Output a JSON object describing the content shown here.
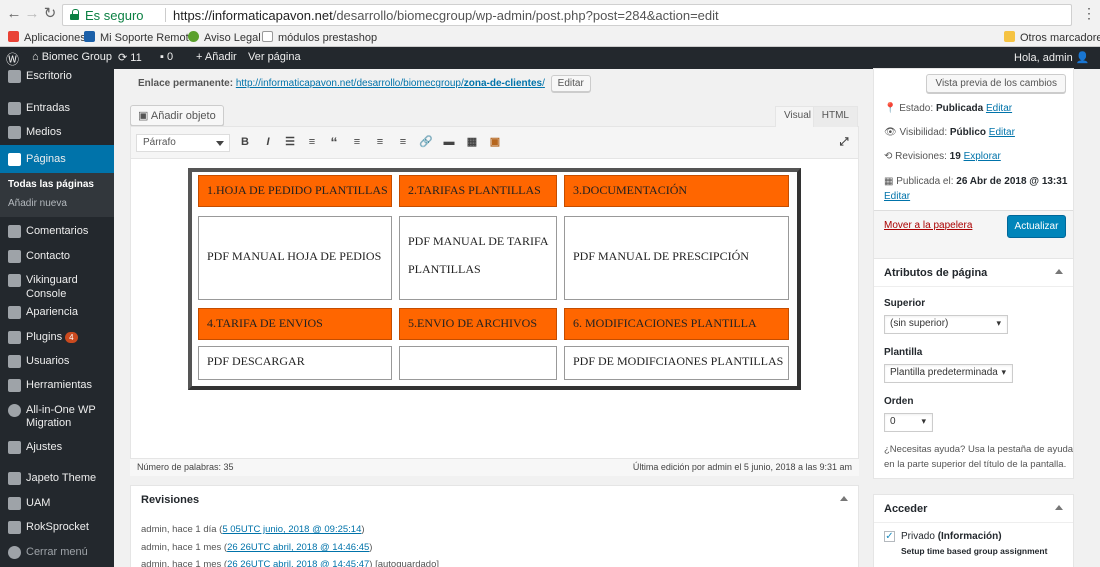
{
  "browser": {
    "secure_label": "Es seguro",
    "url_host": "https://informaticapavon.net",
    "url_path": "/desarrollo/biomecgroup/wp-admin/post.php?post=284&action=edit",
    "bookmarks": [
      "Aplicaciones",
      "Mi Soporte Remoto",
      "Aviso Legal",
      "módulos prestashop"
    ],
    "other_bookmarks": "Otros marcadores"
  },
  "adminbar": {
    "site_name": "Biomec Group",
    "updates_count": "11",
    "comments_count": "0",
    "new_label": "Añadir",
    "view_page": "Ver página",
    "greeting": "Hola, admin"
  },
  "sidebar": {
    "items": [
      {
        "label": "Escritorio"
      },
      {
        "label": "Entradas"
      },
      {
        "label": "Medios"
      },
      {
        "label": "Páginas"
      },
      {
        "label": "Comentarios"
      },
      {
        "label": "Contacto"
      },
      {
        "label": "Vikinguard Console"
      },
      {
        "label": "Apariencia"
      },
      {
        "label": "Plugins"
      },
      {
        "label": "Usuarios"
      },
      {
        "label": "Herramientas"
      },
      {
        "label": "All-in-One WP"
      },
      {
        "label": "Ajustes"
      },
      {
        "label": "Japeto Theme"
      },
      {
        "label": "UAM"
      },
      {
        "label": "RokSprocket"
      },
      {
        "label": "Cerrar menú"
      }
    ],
    "aio_line2": "Migration",
    "plugins_badge": "4",
    "submenu": [
      "Todas las páginas",
      "Añadir nueva"
    ]
  },
  "permalink": {
    "label": "Enlace permanente:",
    "url_base": "http://informaticapavon.net/desarrollo/biomecgroup/",
    "slug": "zona-de-clientes",
    "url_end": "/",
    "edit_button": "Editar"
  },
  "editor": {
    "add_media": "Añadir objeto",
    "tab_visual": "Visual",
    "tab_html": "HTML",
    "format_select": "Párrafo",
    "table": {
      "row1": [
        "1.HOJA DE PEDIDO PLANTILLAS",
        "2.TARIFAS PLANTILLAS",
        "3.DOCUMENTACIÓN"
      ],
      "row2": [
        "PDF  MANUAL HOJA DE PEDIOS",
        "PDF  MANUAL DE TARIFA",
        "PLANTILLAS",
        "PDF  MANUAL DE PRESCIPCIÓN"
      ],
      "row3": [
        "4.TARIFA DE ENVIOS",
        "5.ENVIO DE ARCHIVOS",
        "6. MODIFICACIONES PLANTILLA"
      ],
      "row4": [
        "PDF DESCARGAR",
        "",
        "PDF  DE MODIFCIAONES PLANTILLAS"
      ]
    },
    "word_count": "Número de palabras: 35",
    "last_edit": "Última edición por admin el 5 junio, 2018 a las 9:31 am",
    "colors": {
      "orange_cell": "#ff6600"
    }
  },
  "revisions": {
    "title": "Revisiones",
    "entries": [
      {
        "prefix": "admin, hace 1 día (",
        "link": "5 05UTC junio, 2018 @ 09:25:14",
        "suffix": ")"
      },
      {
        "prefix": "admin, hace 1 mes (",
        "link": "26 26UTC abril, 2018 @ 14:46:45",
        "suffix": ")"
      },
      {
        "prefix": "admin, hace 1 mes (",
        "link": "26 26UTC abril, 2018 @ 14:45:47",
        "suffix": ") [autoguardado]"
      }
    ]
  },
  "publish": {
    "preview_button": "Vista previa de los cambios",
    "status_label": "Estado:",
    "status_value": "Publicada",
    "visibility_label": "Visibilidad:",
    "visibility_value": "Público",
    "revisions_label": "Revisiones:",
    "revisions_value": "19",
    "edit": "Editar",
    "explore": "Explorar",
    "published_label": "Publicada el:",
    "published_value": "26 Abr de 2018 @ 13:31",
    "trash_link": "Mover a la papelera",
    "update_button": "Actualizar"
  },
  "attributes": {
    "title": "Atributos de página",
    "parent_label": "Superior",
    "parent_value": "(sin superior)",
    "template_label": "Plantilla",
    "template_value": "Plantilla predeterminada",
    "order_label": "Orden",
    "order_value": "0",
    "help_text_1": "¿Necesitas ayuda? Usa la pestaña de ayuda",
    "help_text_2": "en la parte superior del título de la pantalla."
  },
  "access": {
    "title": "Acceder",
    "private_label": "Privado",
    "private_info": "(Información)",
    "time_group": "Setup time based group assignment"
  }
}
